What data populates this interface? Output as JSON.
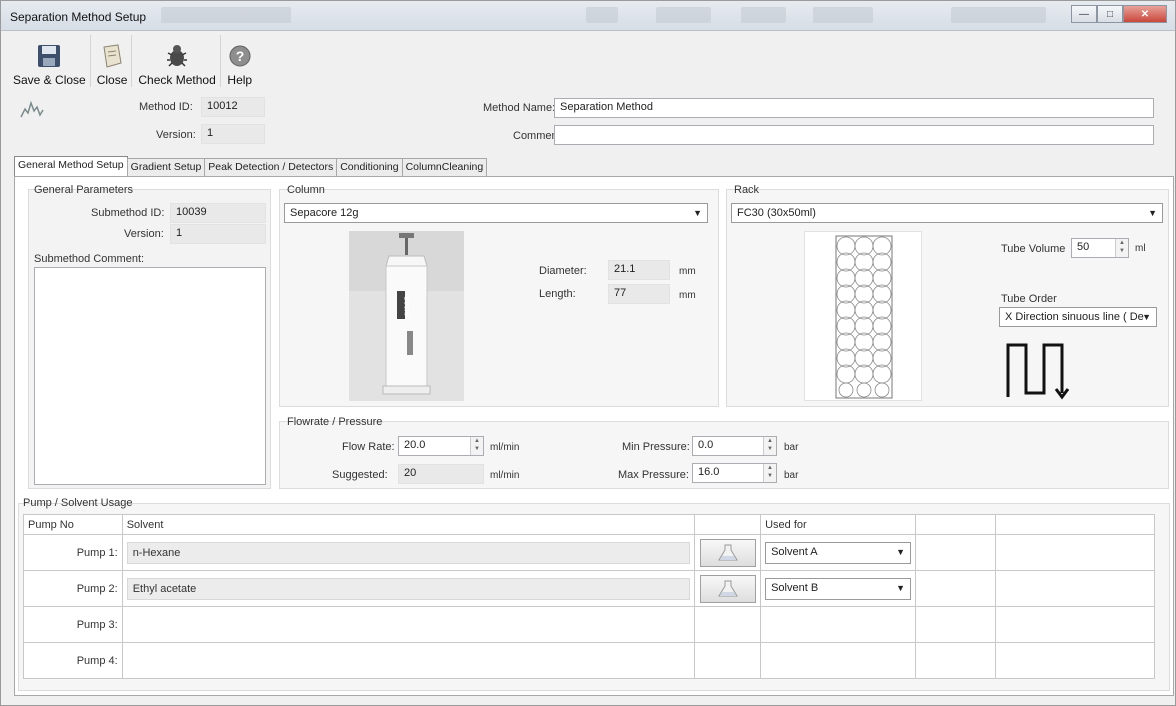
{
  "window": {
    "title": "Separation Method Setup"
  },
  "toolbar": {
    "save_close": "Save & Close",
    "close": "Close",
    "check_method": "Check Method",
    "help": "Help"
  },
  "header": {
    "method_id_label": "Method ID:",
    "method_id": "10012",
    "version_label": "Version:",
    "version": "1",
    "method_name_label": "Method Name:",
    "method_name": "Separation Method",
    "comment_label": "Comment",
    "comment": ""
  },
  "tabs": [
    {
      "label": "General Method Setup"
    },
    {
      "label": "Gradient Setup"
    },
    {
      "label": "Peak Detection / Detectors"
    },
    {
      "label": "Conditioning"
    },
    {
      "label": "ColumnCleaning"
    }
  ],
  "general": {
    "title": "General Parameters",
    "submethod_id_label": "Submethod ID:",
    "submethod_id": "10039",
    "version_label": "Version:",
    "version": "1",
    "comment_label": "Submethod Comment:"
  },
  "column": {
    "title": "Column",
    "selected": "Sepacore 12g",
    "diameter_label": "Diameter:",
    "diameter": "21.1",
    "diameter_unit": "mm",
    "length_label": "Length:",
    "length": "77",
    "length_unit": "mm",
    "brand_text": "BUCHI"
  },
  "rack": {
    "title": "Rack",
    "selected": "FC30 (30x50ml)",
    "tube_volume_label": "Tube Volume",
    "tube_volume": "50",
    "tube_volume_unit": "ml",
    "tube_order_label": "Tube Order",
    "tube_order": "X Direction sinuous line ( De"
  },
  "flow": {
    "title": "Flowrate / Pressure",
    "flow_rate_label": "Flow Rate:",
    "flow_rate": "20.0",
    "flow_unit": "ml/min",
    "suggested_label": "Suggested:",
    "suggested": "20",
    "suggested_unit": "ml/min",
    "min_pressure_label": "Min Pressure:",
    "min_pressure": "0.0",
    "min_unit": "bar",
    "max_pressure_label": "Max Pressure:",
    "max_pressure": "16.0",
    "max_unit": "bar"
  },
  "pump": {
    "title": "Pump / Solvent Usage",
    "col_pump": "Pump No",
    "col_solvent": "Solvent",
    "col_used": "Used for",
    "rows": [
      {
        "pump": "Pump 1:",
        "solvent": "n-Hexane",
        "used": "Solvent A"
      },
      {
        "pump": "Pump 2:",
        "solvent": "Ethyl acetate",
        "used": "Solvent B"
      },
      {
        "pump": "Pump 3:",
        "solvent": "",
        "used": ""
      },
      {
        "pump": "Pump 4:",
        "solvent": "",
        "used": ""
      }
    ]
  }
}
